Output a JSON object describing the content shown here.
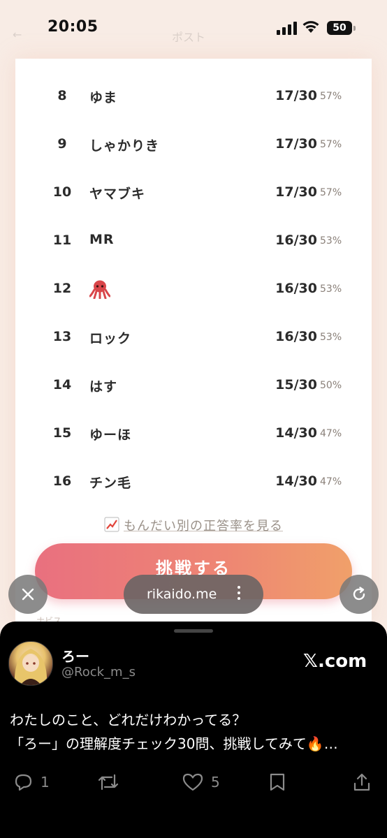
{
  "status_bar": {
    "time": "20:05",
    "battery": "50"
  },
  "background_nav": {
    "back": "←",
    "title": "ポスト"
  },
  "ranking": [
    {
      "rank": "8",
      "name": "ゆま",
      "score": "17/30",
      "percent": "57%"
    },
    {
      "rank": "9",
      "name": "しゃかりき",
      "score": "17/30",
      "percent": "57%"
    },
    {
      "rank": "10",
      "name": "ヤマブキ",
      "score": "17/30",
      "percent": "57%"
    },
    {
      "rank": "11",
      "name": "MR",
      "score": "16/30",
      "percent": "53%"
    },
    {
      "rank": "12",
      "name": "",
      "score": "16/30",
      "percent": "53%",
      "icon": "octopus-emoji"
    },
    {
      "rank": "13",
      "name": "ロック",
      "score": "16/30",
      "percent": "53%"
    },
    {
      "rank": "14",
      "name": "はす",
      "score": "15/30",
      "percent": "50%"
    },
    {
      "rank": "15",
      "name": "ゆーほ",
      "score": "14/30",
      "percent": "47%"
    },
    {
      "rank": "16",
      "name": "チン毛",
      "score": "14/30",
      "percent": "47%"
    }
  ],
  "stats_link": {
    "label": "もんだい別の正答率を見る",
    "icon": "chart-increasing-icon"
  },
  "cta": {
    "label": "挑戦する"
  },
  "footer_note": "ナビス",
  "browser": {
    "url": "rikaido.me",
    "close_icon": "close-icon",
    "reload_icon": "reload-icon",
    "more_icon": "more-vertical-icon"
  },
  "tweet": {
    "author_name": "ろー",
    "author_handle": "@Rock_m_s",
    "source": "𝕏.com",
    "text_line1": "わたしのこと、どれだけわかってる？",
    "text_line2": "「ろー」の理解度チェック30問、挑戦してみて🔥…",
    "replies": "1",
    "likes": "5"
  },
  "colors": {
    "cta_start": "#e9707f",
    "cta_end": "#f0a06a",
    "page_bg": "#f8ece5",
    "sheet_bg": "#000000"
  }
}
